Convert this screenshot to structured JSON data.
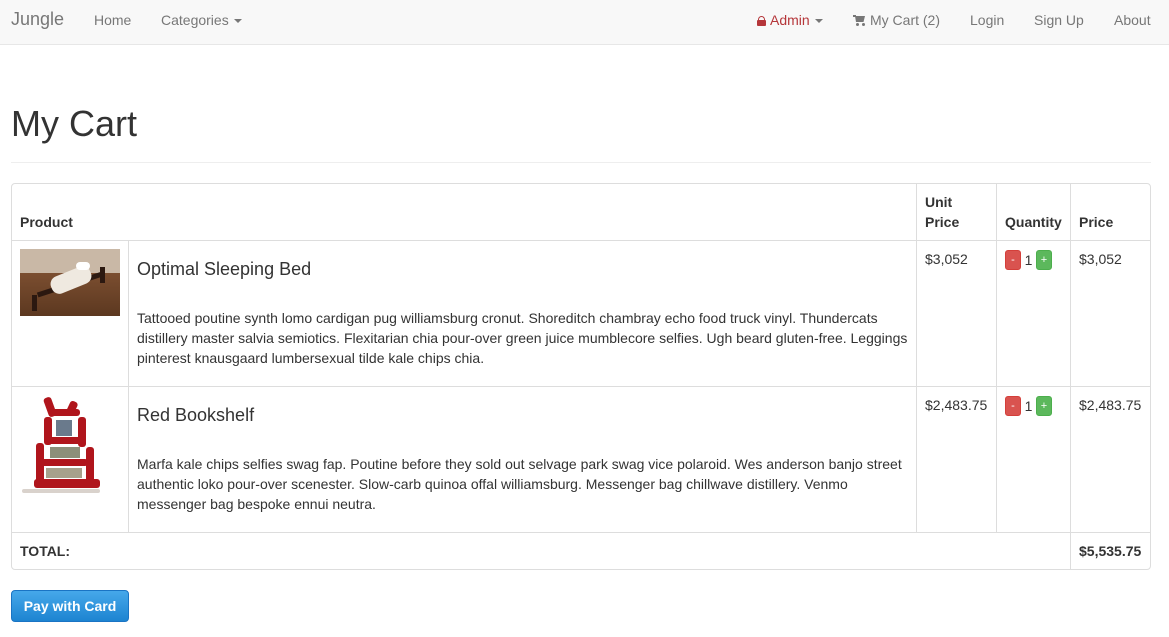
{
  "navbar": {
    "brand": "Jungle",
    "home": "Home",
    "categories": "Categories",
    "admin": "Admin",
    "my_cart": "My Cart (2)",
    "login": "Login",
    "signup": "Sign Up",
    "about": "About"
  },
  "page": {
    "title": "My Cart"
  },
  "table": {
    "headers": {
      "product": "Product",
      "unit_price_1": "Unit",
      "unit_price_2": "Price",
      "quantity": "Quantity",
      "price": "Price"
    },
    "rows": [
      {
        "name": "Optimal Sleeping Bed",
        "description": "Tattooed poutine synth lomo cardigan pug williamsburg cronut. Shoreditch chambray echo food truck vinyl. Thundercats distillery master salvia semiotics. Flexitarian chia pour-over green juice mumblecore selfies. Ugh beard gluten-free. Leggings pinterest knausgaard lumbersexual tilde kale chips chia.",
        "unit_price": "$3,052",
        "minus": "-",
        "quantity": "1",
        "plus": "+",
        "price": "$3,052",
        "image_icon": "bed-photo"
      },
      {
        "name": "Red Bookshelf",
        "description": "Marfa kale chips selfies swag fap. Poutine before they sold out selvage park swag vice polaroid. Wes anderson banjo street authentic loko pour-over scenester. Slow-carb quinoa offal williamsburg. Messenger bag chillwave distillery. Venmo messenger bag bespoke ennui neutra.",
        "unit_price": "$2,483.75",
        "minus": "-",
        "quantity": "1",
        "plus": "+",
        "price": "$2,483.75",
        "image_icon": "bookshelf-photo"
      }
    ],
    "total_label": "TOTAL:",
    "total_value": "$5,535.75"
  },
  "actions": {
    "pay_label": "Pay with Card"
  },
  "colors": {
    "navbar_bg": "#f8f8f8",
    "admin": "#b5363a",
    "minus_btn": "#d9534f",
    "plus_btn": "#5cb85c",
    "pay_btn": "#1d84d1"
  }
}
